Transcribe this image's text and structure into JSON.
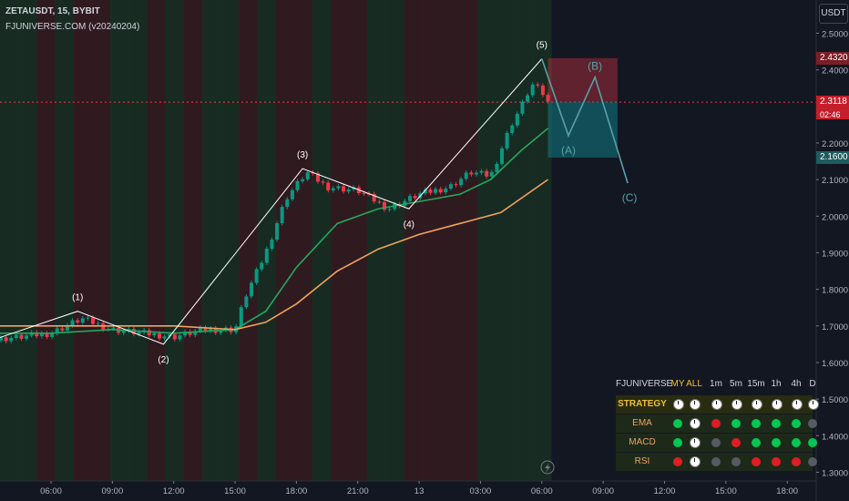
{
  "header": {
    "symbol_line": "ZETAUSDT, 15, BYBIT",
    "indicator_line": "FJUNIVERSE.COM (v20240204)"
  },
  "currency_button": "USDT",
  "colors": {
    "bg": "#131722",
    "up": "#089981",
    "down": "#f23645",
    "ema_fast": "#26a65b",
    "ema_slow": "#f0a35e",
    "wave": "#ffffff",
    "projection": "#5aa0a8",
    "target_red": "#f23645",
    "target_teal": "#137c84",
    "panel_header": "#f0c030"
  },
  "price_labels": [
    {
      "text": "2.4320",
      "kind": "red"
    },
    {
      "text": "2.3118",
      "kind": "red-current",
      "sub": "02:46"
    },
    {
      "text": "2.1600",
      "kind": "teal"
    }
  ],
  "chart_data": {
    "type": "line",
    "title": "",
    "ylim": [
      1.26,
      2.56
    ],
    "y_ticks": [
      "2.5000",
      "2.4000",
      "2.3000",
      "2.2000",
      "2.1000",
      "2.0000",
      "1.9000",
      "1.8000",
      "1.7000",
      "1.6000",
      "1.5000",
      "1.4000",
      "1.3000"
    ],
    "x_ticks": [
      "06:00",
      "09:00",
      "12:00",
      "15:00",
      "18:00",
      "21:00",
      "13",
      "03:00",
      "06:00",
      "09:00",
      "12:00",
      "15:00",
      "18:00"
    ],
    "x_tick_hours": [
      6,
      9,
      12,
      15,
      18,
      21,
      24,
      27,
      30,
      33,
      36,
      39,
      42
    ],
    "series": [
      {
        "x_hours": [
          1.5,
          3.0,
          4.5,
          6.0,
          7.5,
          9.0,
          10.5,
          12.0,
          13.5,
          15.0,
          15.5,
          16.5,
          17.5,
          18.5,
          19.5,
          21.0,
          22.5,
          24.0,
          25.5,
          26.5,
          27.5,
          28.5,
          29.0,
          29.5,
          30.0,
          30.3
        ],
        "values": [
          1.66,
          1.66,
          1.67,
          1.68,
          1.72,
          1.69,
          1.68,
          1.67,
          1.69,
          1.69,
          1.78,
          1.9,
          2.05,
          2.12,
          2.08,
          2.07,
          2.02,
          2.06,
          2.08,
          2.12,
          2.11,
          2.25,
          2.3,
          2.36,
          2.34,
          2.31
        ]
      },
      {
        "name": "EMA",
        "x_hours": [
          0,
          3,
          6,
          9,
          12,
          15,
          16.5,
          18,
          20,
          22,
          24,
          26,
          27.5,
          29,
          30.3
        ],
        "values": [
          1.69,
          1.68,
          1.68,
          1.69,
          1.68,
          1.69,
          1.74,
          1.86,
          1.98,
          2.02,
          2.04,
          2.06,
          2.1,
          2.18,
          2.24
        ]
      },
      {
        "name": "EMA",
        "x_hours": [
          0,
          3,
          6,
          9,
          12,
          15,
          16.5,
          18,
          20,
          22,
          24,
          26,
          28,
          30.3
        ],
        "values": [
          1.71,
          1.7,
          1.7,
          1.7,
          1.7,
          1.69,
          1.71,
          1.76,
          1.85,
          1.91,
          1.95,
          1.98,
          2.01,
          2.1
        ]
      }
    ],
    "waves": [
      {
        "label": "(1)",
        "x_hours": 7.3,
        "y": 1.74,
        "label_pos": "above"
      },
      {
        "label": "(2)",
        "x_hours": 11.5,
        "y": 1.65,
        "label_pos": "below"
      },
      {
        "label": "(3)",
        "x_hours": 18.3,
        "y": 2.13,
        "label_pos": "above"
      },
      {
        "label": "(4)",
        "x_hours": 23.5,
        "y": 2.02,
        "label_pos": "below"
      },
      {
        "label": "(5)",
        "x_hours": 30.0,
        "y": 2.43,
        "label_pos": "above"
      }
    ],
    "wave_start": {
      "x_hours": 2.0,
      "y": 1.64
    },
    "projection": [
      {
        "label": "",
        "x_hours": 30.0,
        "y": 2.43
      },
      {
        "label": "(A)",
        "x_hours": 31.3,
        "y": 2.22
      },
      {
        "label": "(B)",
        "x_hours": 32.6,
        "y": 2.38
      },
      {
        "label": "(C)",
        "x_hours": 34.2,
        "y": 2.09
      }
    ],
    "target_zone": {
      "x_hours_from": 30.3,
      "x_hours_to": 33.7,
      "top": 2.432,
      "mid": 2.3118,
      "bottom": 2.16
    },
    "current_price": 2.3118,
    "grid": false
  },
  "panel": {
    "title": "FJUNIVERSE",
    "columns": [
      "MY",
      "ALL",
      "1m",
      "5m",
      "15m",
      "1h",
      "4h",
      "D"
    ],
    "rows": [
      {
        "label": "STRATEGY",
        "cells": [
          "clock",
          "clock",
          "clock",
          "clock",
          "clock",
          "clock",
          "clock",
          "clock"
        ]
      },
      {
        "label": "EMA",
        "cells": [
          "green",
          "clock",
          "red",
          "green",
          "green",
          "green",
          "green",
          "gray"
        ]
      },
      {
        "label": "MACD",
        "cells": [
          "green",
          "clock",
          "gray",
          "red",
          "green",
          "green",
          "green",
          "green"
        ]
      },
      {
        "label": "RSI",
        "cells": [
          "red",
          "clock",
          "gray",
          "gray",
          "red",
          "red",
          "red",
          "gray"
        ]
      }
    ]
  }
}
